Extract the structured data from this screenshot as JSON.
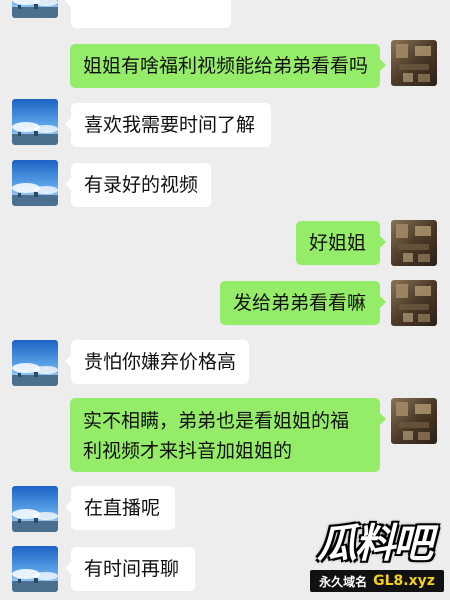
{
  "messages": [
    {
      "side": "in",
      "text": ""
    },
    {
      "side": "out",
      "text": "姐姐有啥福利视频能给弟弟看看吗"
    },
    {
      "side": "in",
      "text": "喜欢我需要时间了解"
    },
    {
      "side": "in",
      "text": "有录好的视频"
    },
    {
      "side": "out",
      "text": "好姐姐"
    },
    {
      "side": "out",
      "text": "发给弟弟看看嘛"
    },
    {
      "side": "in",
      "text": "贵怕你嫌弃价格高"
    },
    {
      "side": "out",
      "text": "实不相瞒，弟弟也是看姐姐的福利视频才来抖音加姐姐的"
    },
    {
      "side": "in",
      "text": "在直播呢"
    },
    {
      "side": "in",
      "text": "有时间再聊"
    }
  ],
  "watermark": {
    "logo_text": "瓜料吧",
    "tagline": "永久域名",
    "domain": "GL8.xyz"
  },
  "colors": {
    "background": "#ededed",
    "incoming_bubble": "#ffffff",
    "outgoing_bubble": "#95ec69"
  },
  "icons": {
    "contact_avatar": "sky-landscape-avatar",
    "self_avatar": "brown-photo-avatar"
  }
}
